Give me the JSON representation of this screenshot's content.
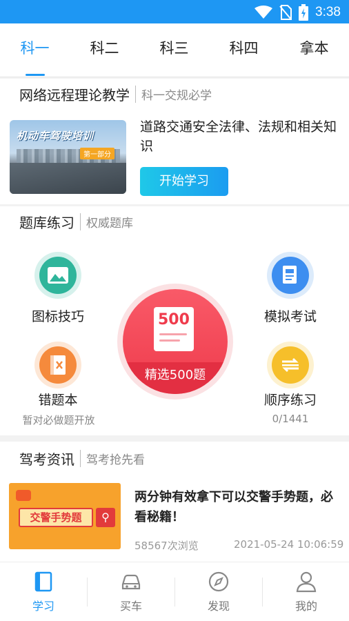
{
  "status_bar": {
    "time": "3:38",
    "icons": [
      "wifi-icon",
      "no-sim-icon",
      "battery-charging-icon"
    ]
  },
  "tabs": [
    {
      "label": "科一",
      "active": true
    },
    {
      "label": "科二",
      "active": false
    },
    {
      "label": "科三",
      "active": false
    },
    {
      "label": "科四",
      "active": false
    },
    {
      "label": "拿本",
      "active": false
    }
  ],
  "remote_section": {
    "title": "网络远程理论教学",
    "subtitle": "科一交规必学",
    "lesson": {
      "thumb_title": "机动车驾驶培训",
      "thumb_tag": "第一部分",
      "title": "道路交通安全法律、法规和相关知识",
      "button": "开始学习"
    }
  },
  "practice_section": {
    "title": "题库练习",
    "subtitle": "权威题库",
    "items": [
      {
        "label": "图标技巧",
        "icon": "image-icon"
      },
      {
        "label": "模拟考试",
        "icon": "exam-paper-icon"
      },
      {
        "label": "错题本",
        "icon": "wrong-notebook-icon",
        "note": "暂对必做题开放"
      },
      {
        "label": "顺序练习",
        "icon": "sequence-icon",
        "note": "0/1441"
      }
    ],
    "featured": {
      "number": "500",
      "label": "精选500题"
    }
  },
  "news_section": {
    "title": "驾考资讯",
    "subtitle": "驾考抢先看",
    "article": {
      "thumb_text": "交警手势题",
      "title": "两分钟有效拿下可以交警手势题，必看秘籍！",
      "views": "58567次浏览",
      "date": "2021-05-24 10:06:59"
    }
  },
  "bottom_nav": [
    {
      "label": "学习",
      "icon": "book-icon",
      "active": true
    },
    {
      "label": "买车",
      "icon": "car-icon",
      "active": false
    },
    {
      "label": "发现",
      "icon": "compass-icon",
      "active": false
    },
    {
      "label": "我的",
      "icon": "person-icon",
      "active": false
    }
  ],
  "colors": {
    "accent": "#1e97f3",
    "featured_red": "#ef3b4c"
  }
}
